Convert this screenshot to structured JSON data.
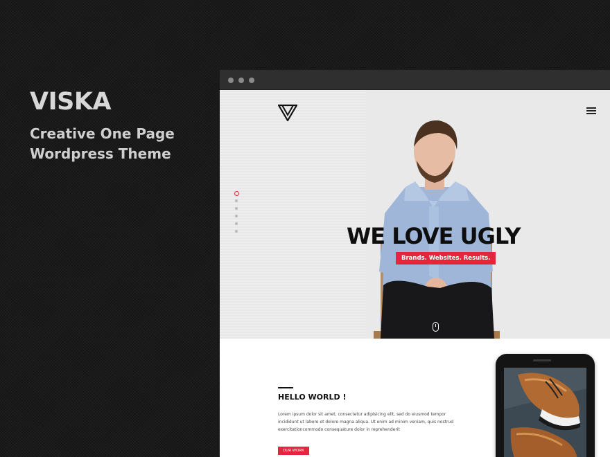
{
  "promo": {
    "title": "VISKA",
    "subtitle_line1": "Creative One Page",
    "subtitle_line2": "Wordpress Theme"
  },
  "hero": {
    "headline": "WE LOVE UGLY",
    "tagline": "Brands. Websites. Results.",
    "logo_icon": "viska-logo-icon",
    "menu_icon": "hamburger-menu-icon",
    "scroll_icon": "mouse-scroll-icon",
    "nav_dots_count": 6,
    "active_dot_index": 0
  },
  "content": {
    "heading": "HELLO WORLD !",
    "body": "Lorem ipsum dolor sit amet, consectetur adipisicing elit, sed do eiusmod tempor incididunt ut labore et dolore magna aliqua. Ut enim ad minim veniam, quis nostrud exercitationcommodo consequature dolor in reprehenderit",
    "button_label": "OUR WORK"
  },
  "colors": {
    "accent": "#e3263d",
    "dark_bg": "#1a1a1a",
    "browser_bar": "#2f2f2f"
  }
}
